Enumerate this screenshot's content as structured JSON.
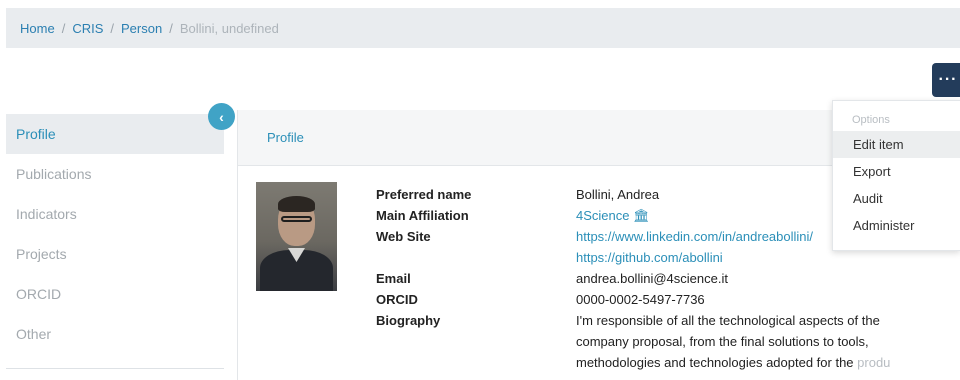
{
  "breadcrumb": {
    "items": [
      "Home",
      "CRIS",
      "Person"
    ],
    "separator": "/",
    "current": "Bollini, undefined"
  },
  "options_button": {
    "label": "···"
  },
  "options_menu": {
    "header": "Options",
    "items": [
      "Edit item",
      "Export",
      "Audit",
      "Administer"
    ]
  },
  "sidebar": {
    "collapse_icon": "‹",
    "items": [
      "Profile",
      "Publications",
      "Indicators",
      "Projects",
      "ORCID",
      "Other"
    ],
    "active_index": 0
  },
  "panel": {
    "title": "Profile"
  },
  "profile": {
    "labels": {
      "preferred_name": "Preferred name",
      "main_affiliation": "Main Affiliation",
      "web_site": "Web Site",
      "email": "Email",
      "orcid": "ORCID",
      "biography": "Biography"
    },
    "preferred_name": "Bollini, Andrea",
    "main_affiliation": "4Science",
    "affiliation_icon": "institution-icon",
    "web_sites": [
      "https://www.linkedin.com/in/andreabollini/",
      "https://github.com/abollini"
    ],
    "email": "andrea.bollini@4science.it",
    "orcid": "0000-0002-5497-7736",
    "biography_visible": "I'm responsible of all the technological aspects of the company proposal, from the final solutions to tools, methodologies and technologies adopted for the ",
    "biography_faded": "produ"
  },
  "colors": {
    "link": "#2b8fb8",
    "options_button": "#233c5b",
    "collapse_button": "#40a3c6",
    "breadcrumb_bg": "#e9ecef"
  }
}
